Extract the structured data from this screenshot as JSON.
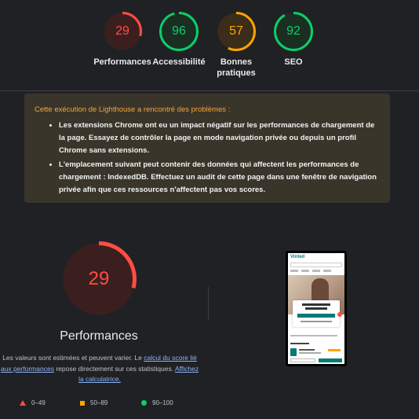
{
  "colors": {
    "fail": "#ff4e42",
    "average": "#ffa400",
    "pass": "#0cce6b",
    "fail_bg": "#3b1f1f",
    "average_bg": "#3a2d19",
    "pass_bg": "#1b2e22"
  },
  "gauges": [
    {
      "label": "Performances",
      "score": "29",
      "level": "fail"
    },
    {
      "label": "Accessibilité",
      "score": "96",
      "level": "pass"
    },
    {
      "label": "Bonnes pratiques",
      "score": "57",
      "level": "average"
    },
    {
      "label": "SEO",
      "score": "92",
      "level": "pass"
    }
  ],
  "warning": {
    "title": "Cette exécution de Lighthouse a rencontré des problèmes :",
    "items": [
      "Les extensions Chrome ont eu un impact négatif sur les performances de chargement de la page. Essayez de contrôler la page en mode navigation privée ou depuis un profil Chrome sans extensions.",
      "L'emplacement suivant peut contenir des données qui affectent les performances de chargement : IndexedDB. Effectuez un audit de cette page dans une fenêtre de navigation privée afin que ces ressources n'affectent pas vos scores."
    ]
  },
  "performance": {
    "score": "29",
    "level": "fail",
    "title": "Performances",
    "desc_before": "Les valeurs sont estimées et peuvent varier. Le ",
    "link_calc": "calcul du score lié aux performances",
    "desc_middle": " repose directement sur ces statistiques. ",
    "link_calculator": "Affichez la calculatrice."
  },
  "legend": [
    {
      "range": "0–49",
      "shape": "triangle-icon",
      "level": "fail"
    },
    {
      "range": "50–89",
      "shape": "square-icon",
      "level": "average"
    },
    {
      "range": "90–100",
      "shape": "circle-icon",
      "level": "pass"
    }
  ],
  "screenshot": {
    "logo": "Vinted"
  }
}
